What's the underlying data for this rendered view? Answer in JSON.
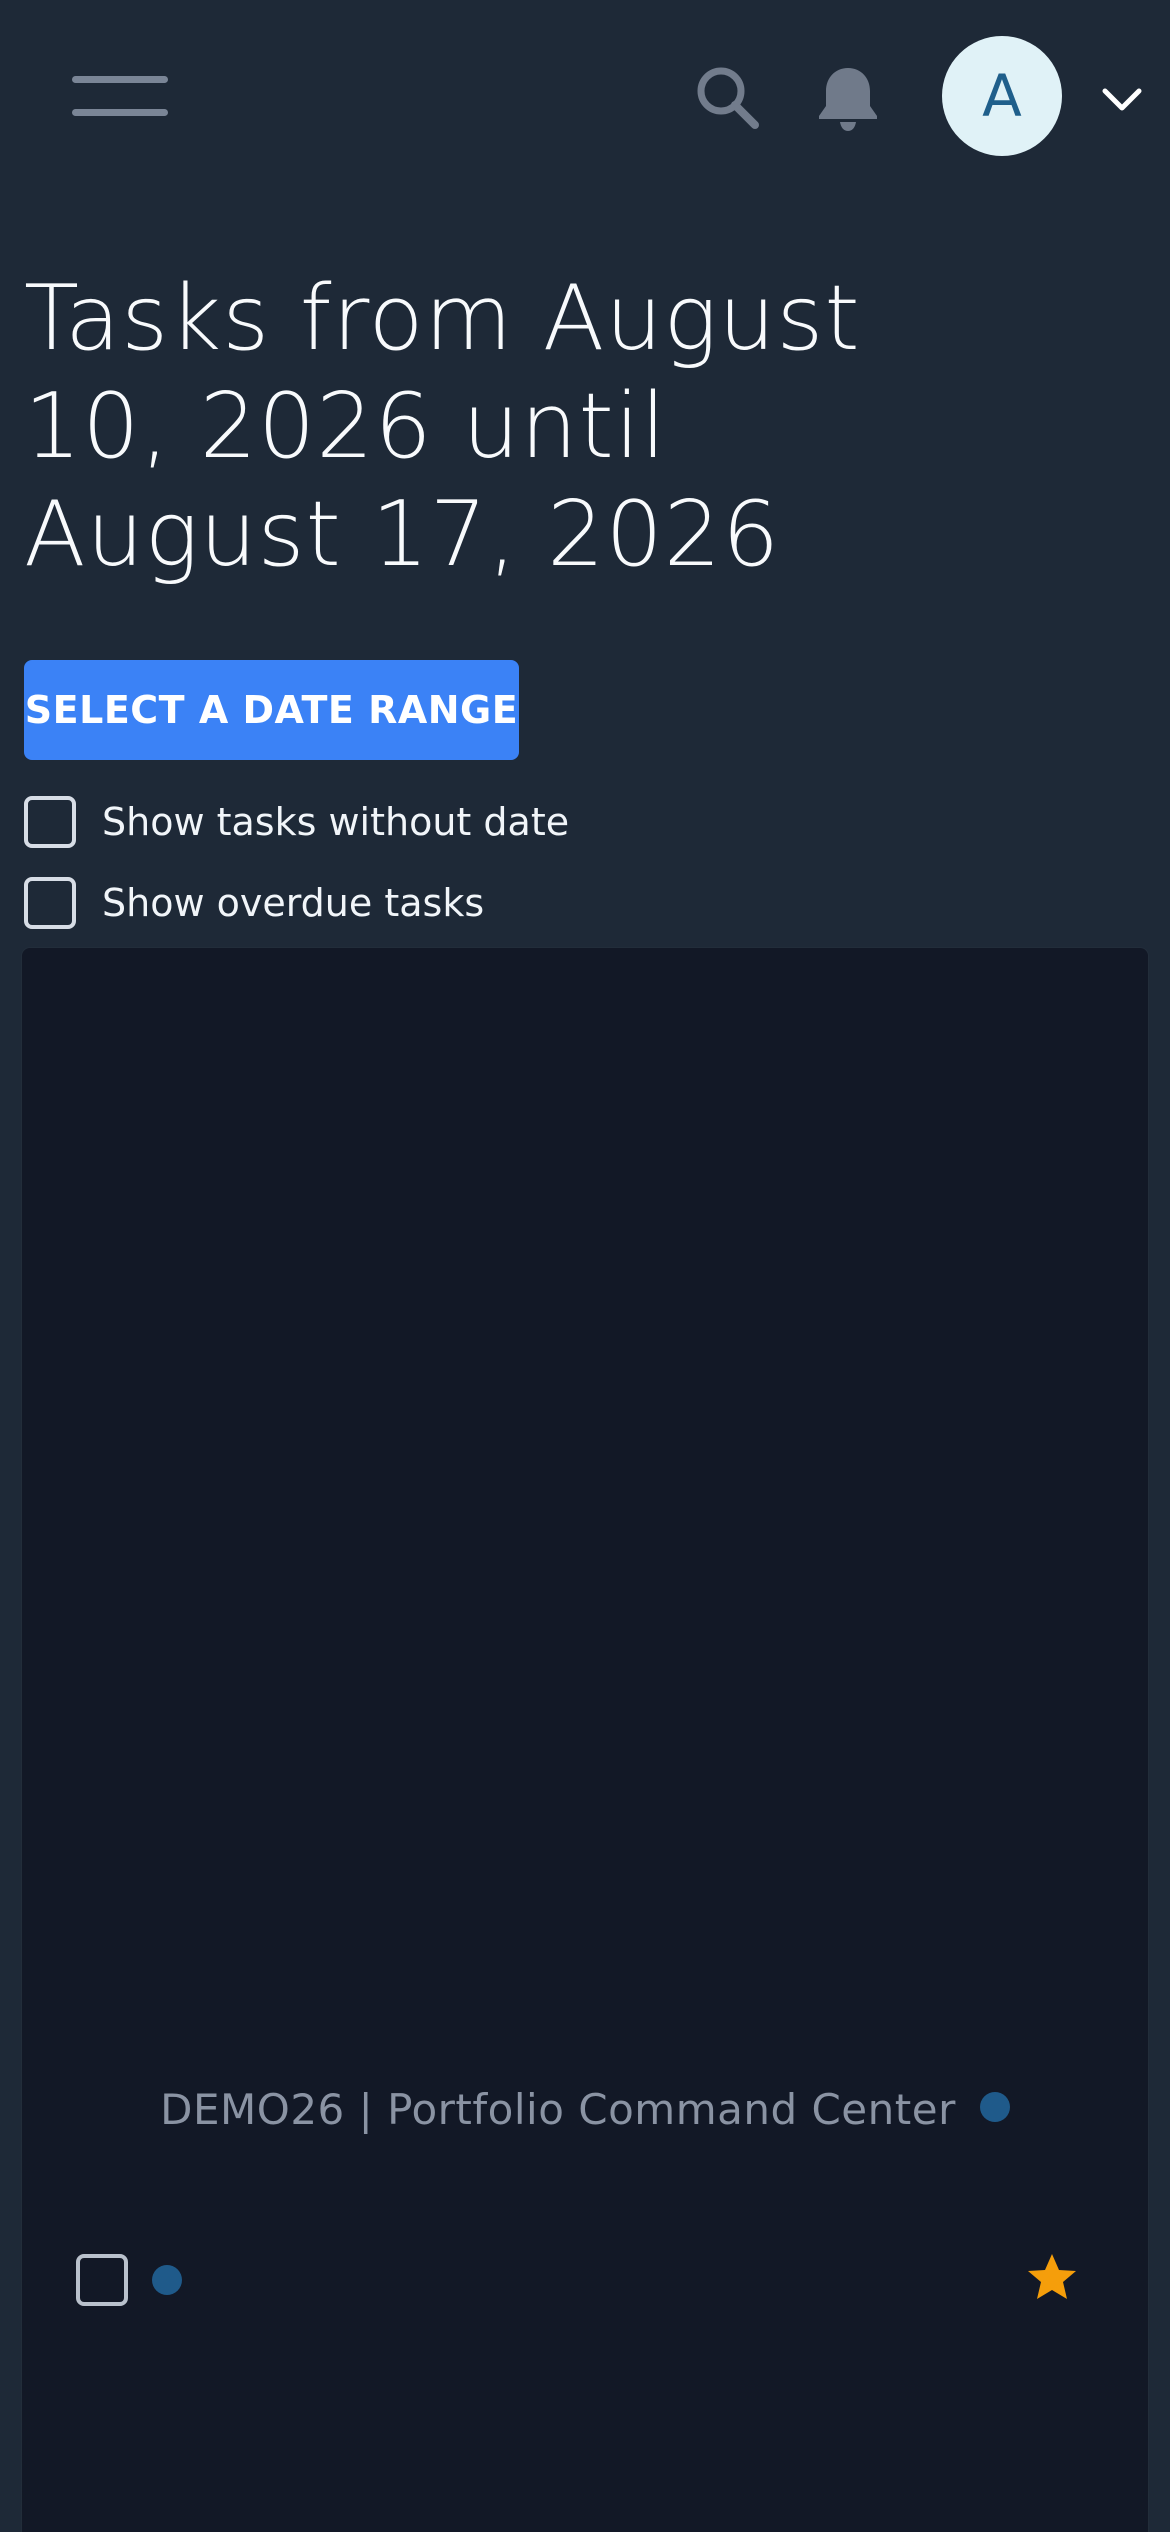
{
  "app": {
    "colors": {
      "background": "#1e2937",
      "panel": "#121826",
      "accent": "#3b82f6",
      "star": "#f59e0b",
      "dot": "#1f5a8a"
    }
  },
  "topbar": {
    "menu_icon": "hamburger-icon",
    "search_icon": "search-icon",
    "bell_icon": "bell-icon",
    "avatar_initial": "A",
    "dropdown_icon": "chevron-down-icon"
  },
  "main": {
    "title": "Tasks from August 10, 2026 until August 17, 2026",
    "date_range_button": "SELECT A DATE RANGE",
    "filters": [
      {
        "label": "Show tasks without date",
        "checked": false
      },
      {
        "label": "Show overdue tasks",
        "checked": false
      }
    ]
  },
  "panel": {
    "project_title": "DEMO26 | Portfolio Command Center",
    "task": {
      "checked": false,
      "favorite": true,
      "icons": [
        "checkbox-icon",
        "dot-icon",
        "star-icon"
      ]
    }
  }
}
